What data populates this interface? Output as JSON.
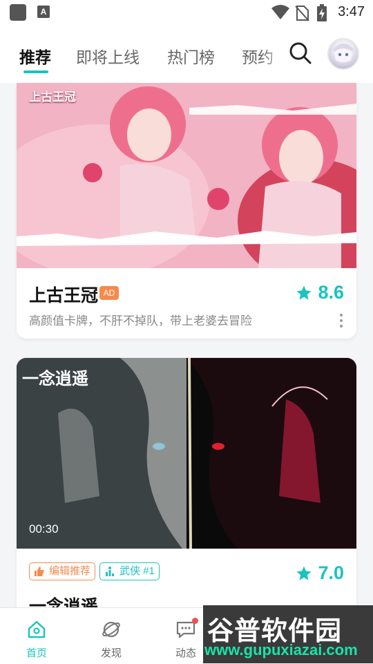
{
  "status_bar": {
    "time": "3:47",
    "notification_letter": "A"
  },
  "tabs": [
    {
      "label": "推荐"
    },
    {
      "label": "即将上线"
    },
    {
      "label": "热门榜"
    },
    {
      "label": "预约"
    }
  ],
  "games": [
    {
      "title": "上古王冠",
      "badge": "AD",
      "score": "8.6",
      "description": "高颜值卡牌，不肝不掉队，带上老婆去冒险",
      "art_logo": "上古王冠"
    },
    {
      "title": "一念逍遥",
      "score": "7.0",
      "duration": "00:30",
      "tags": [
        "编辑推荐",
        "武侠 #1"
      ],
      "art_logo": "一念逍遥"
    }
  ],
  "bottom_nav": [
    {
      "label": "首页",
      "icon": "home-icon"
    },
    {
      "label": "发现",
      "icon": "discover-planet-icon"
    },
    {
      "label": "动态",
      "icon": "message-icon"
    }
  ],
  "watermark": {
    "title": "谷普软件园",
    "url": "www.gupuxiazai.com"
  },
  "colors": {
    "accent": "#19c3c0",
    "ad_badge": "#f58a4b",
    "notify_dot": "#f04f4f"
  }
}
